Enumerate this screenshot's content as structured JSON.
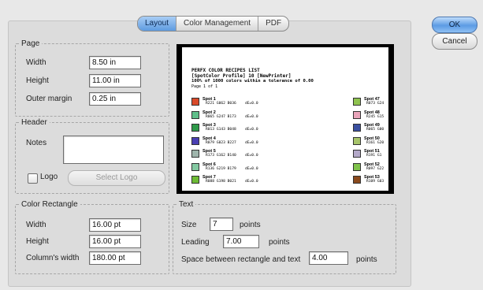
{
  "tabs": [
    {
      "label": "Layout",
      "active": true
    },
    {
      "label": "Color Management",
      "active": false
    },
    {
      "label": "PDF",
      "active": false
    }
  ],
  "buttons": {
    "ok": "OK",
    "cancel": "Cancel"
  },
  "page": {
    "legend": "Page",
    "width_label": "Width",
    "width_value": "8.50 in",
    "height_label": "Height",
    "height_value": "11.00 in",
    "margin_label": "Outer margin",
    "margin_value": "0.25 in"
  },
  "header": {
    "legend": "Header",
    "notes_label": "Notes",
    "logo_label": "Logo",
    "select_logo": "Select Logo"
  },
  "rect": {
    "legend": "Color Rectangle",
    "width_label": "Width",
    "width_value": "16.00 pt",
    "height_label": "Height",
    "height_value": "16.00 pt",
    "colw_label": "Column's width",
    "colw_value": "180.00 pt"
  },
  "text": {
    "legend": "Text",
    "size_label": "Size",
    "size_value": "7",
    "size_unit": "points",
    "leading_label": "Leading",
    "leading_value": "7.00",
    "leading_unit": "points",
    "space_label": "Space between rectangle and text",
    "space_value": "4.00",
    "space_unit": "points"
  },
  "preview": {
    "title": "PERFX COLOR RECIPES LIST",
    "subtitle": "[SpotColor Profile] 10 [NewPrinter]",
    "line3": "100% of 1000 colors within a tolerance of 0.00",
    "page_label": "Page 1 of 1",
    "left_column": [
      {
        "name": "Spot 1",
        "values": "R221 G062 B036",
        "de": "dE=0.0",
        "color": "#d94a2a"
      },
      {
        "name": "Spot 2",
        "values": "R065 G247 B173",
        "de": "dE=0.0",
        "color": "#5fbf8a"
      },
      {
        "name": "Spot 3",
        "values": "R013 G143 B048",
        "de": "dE=0.0",
        "color": "#2f9a4a"
      },
      {
        "name": "Spot 4",
        "values": "R079 G023 B227",
        "de": "dE=0.0",
        "color": "#4a3fb3"
      },
      {
        "name": "Spot 5",
        "values": "R173 G162 B140",
        "de": "dE=0.0",
        "color": "#9fb5ac"
      },
      {
        "name": "Spot 6",
        "values": "R136 G219 B179",
        "de": "dE=0.0",
        "color": "#84c9a2"
      },
      {
        "name": "Spot 7",
        "values": "R088 G198 B021",
        "de": "dE=0.0",
        "color": "#6dbb35"
      }
    ],
    "right_column": [
      {
        "name": "Spot 47",
        "values": "R073 G24",
        "color": "#8fc34f"
      },
      {
        "name": "Spot 48",
        "values": "R245 G15",
        "color": "#e9a4ba"
      },
      {
        "name": "Spot 49",
        "values": "R065 G00",
        "color": "#3a4fa0"
      },
      {
        "name": "Spot 50",
        "values": "R161 G20",
        "color": "#a7c46a"
      },
      {
        "name": "Spot 51",
        "values": "R191 G1",
        "color": "#b4a9c9"
      },
      {
        "name": "Spot 52",
        "values": "R097 G22",
        "color": "#7fc24b"
      },
      {
        "name": "Spot 53",
        "values": "R109 G03",
        "color": "#8a4a1d"
      }
    ]
  }
}
